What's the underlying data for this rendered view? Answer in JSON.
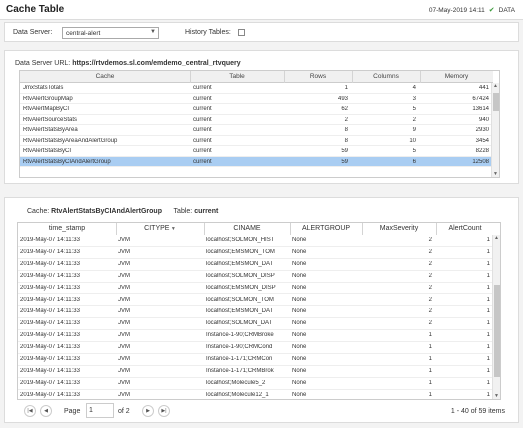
{
  "header": {
    "title": "Cache Table",
    "timestamp": "07-May-2019 14:11",
    "status_label": "DATA"
  },
  "filters": {
    "data_server_label": "Data Server:",
    "data_server_value": "central-alert",
    "history_label": "History Tables:",
    "history_checked": false
  },
  "cache_panel": {
    "url_label": "Data Server URL:",
    "url_value": "https://rtvdemos.sl.com/emdemo_central_rtvquery",
    "columns": [
      "Cache",
      "Table",
      "Rows",
      "Columns",
      "Memory"
    ],
    "rows": [
      [
        "JmxStatsTotals",
        "current",
        "1",
        "4",
        "441"
      ],
      [
        "RtvAlertGroupMap",
        "current",
        "493",
        "3",
        "67424"
      ],
      [
        "RtvAlertMapByCI",
        "current",
        "62",
        "5",
        "13614"
      ],
      [
        "RtvAlertSourceStats",
        "current",
        "2",
        "2",
        "940"
      ],
      [
        "RtvAlertStatsByArea",
        "current",
        "8",
        "9",
        "2930"
      ],
      [
        "RtvAlertStatsByAreaAndAlertGroup",
        "current",
        "8",
        "10",
        "3454"
      ],
      [
        "RtvAlertStatsByCI",
        "current",
        "59",
        "5",
        "8228"
      ],
      [
        "RtvAlertStatsByCIAndAlertGroup",
        "current",
        "59",
        "6",
        "12508"
      ]
    ],
    "selected_row": 7
  },
  "detail_panel": {
    "cache_label": "Cache:",
    "cache_value": "RtvAlertStatsByCIAndAlertGroup",
    "table_label": "Table:",
    "table_value": "current",
    "columns": [
      "time_stamp",
      "CITYPE",
      "CINAME",
      "ALERTGROUP",
      "MaxSeverity",
      "AlertCount"
    ],
    "rows": [
      [
        "2019-May-07 14:11:33",
        "JVM",
        "localhost;SOLMON_HIST",
        "None",
        "2",
        "1"
      ],
      [
        "2019-May-07 14:11:33",
        "JVM",
        "localhost;EMSMON_TOM",
        "None",
        "2",
        "1"
      ],
      [
        "2019-May-07 14:11:33",
        "JVM",
        "localhost;EMSMON_DAT",
        "None",
        "2",
        "1"
      ],
      [
        "2019-May-07 14:11:33",
        "JVM",
        "localhost;SOLMON_DISP",
        "None",
        "2",
        "1"
      ],
      [
        "2019-May-07 14:11:33",
        "JVM",
        "localhost;EMSMON_DISP",
        "None",
        "2",
        "1"
      ],
      [
        "2019-May-07 14:11:33",
        "JVM",
        "localhost;SOLMON_TOM",
        "None",
        "2",
        "1"
      ],
      [
        "2019-May-07 14:11:33",
        "JVM",
        "localhost;EMSMON_DAT",
        "None",
        "2",
        "1"
      ],
      [
        "2019-May-07 14:11:33",
        "JVM",
        "localhost;SOLMON_DAT",
        "None",
        "2",
        "1"
      ],
      [
        "2019-May-07 14:11:33",
        "JVM",
        "Instance-1-90;CRMBroke",
        "None",
        "1",
        "1"
      ],
      [
        "2019-May-07 14:11:33",
        "JVM",
        "Instance-1-90;CRMCond",
        "None",
        "1",
        "1"
      ],
      [
        "2019-May-07 14:11:33",
        "JVM",
        "Instance-1-171;CRMCon",
        "None",
        "1",
        "1"
      ],
      [
        "2019-May-07 14:11:33",
        "JVM",
        "Instance-1-171;CRMBrok",
        "None",
        "1",
        "1"
      ],
      [
        "2019-May-07 14:11:33",
        "JVM",
        "localhost;Molecule5_2",
        "None",
        "1",
        "1"
      ],
      [
        "2019-May-07 14:11:33",
        "JVM",
        "localhost;Molecule12_1",
        "None",
        "1",
        "1"
      ]
    ]
  },
  "pager": {
    "page_label": "Page",
    "page_value": "1",
    "of_label": "of 2",
    "count_label": "1 - 40 of 59 items"
  }
}
